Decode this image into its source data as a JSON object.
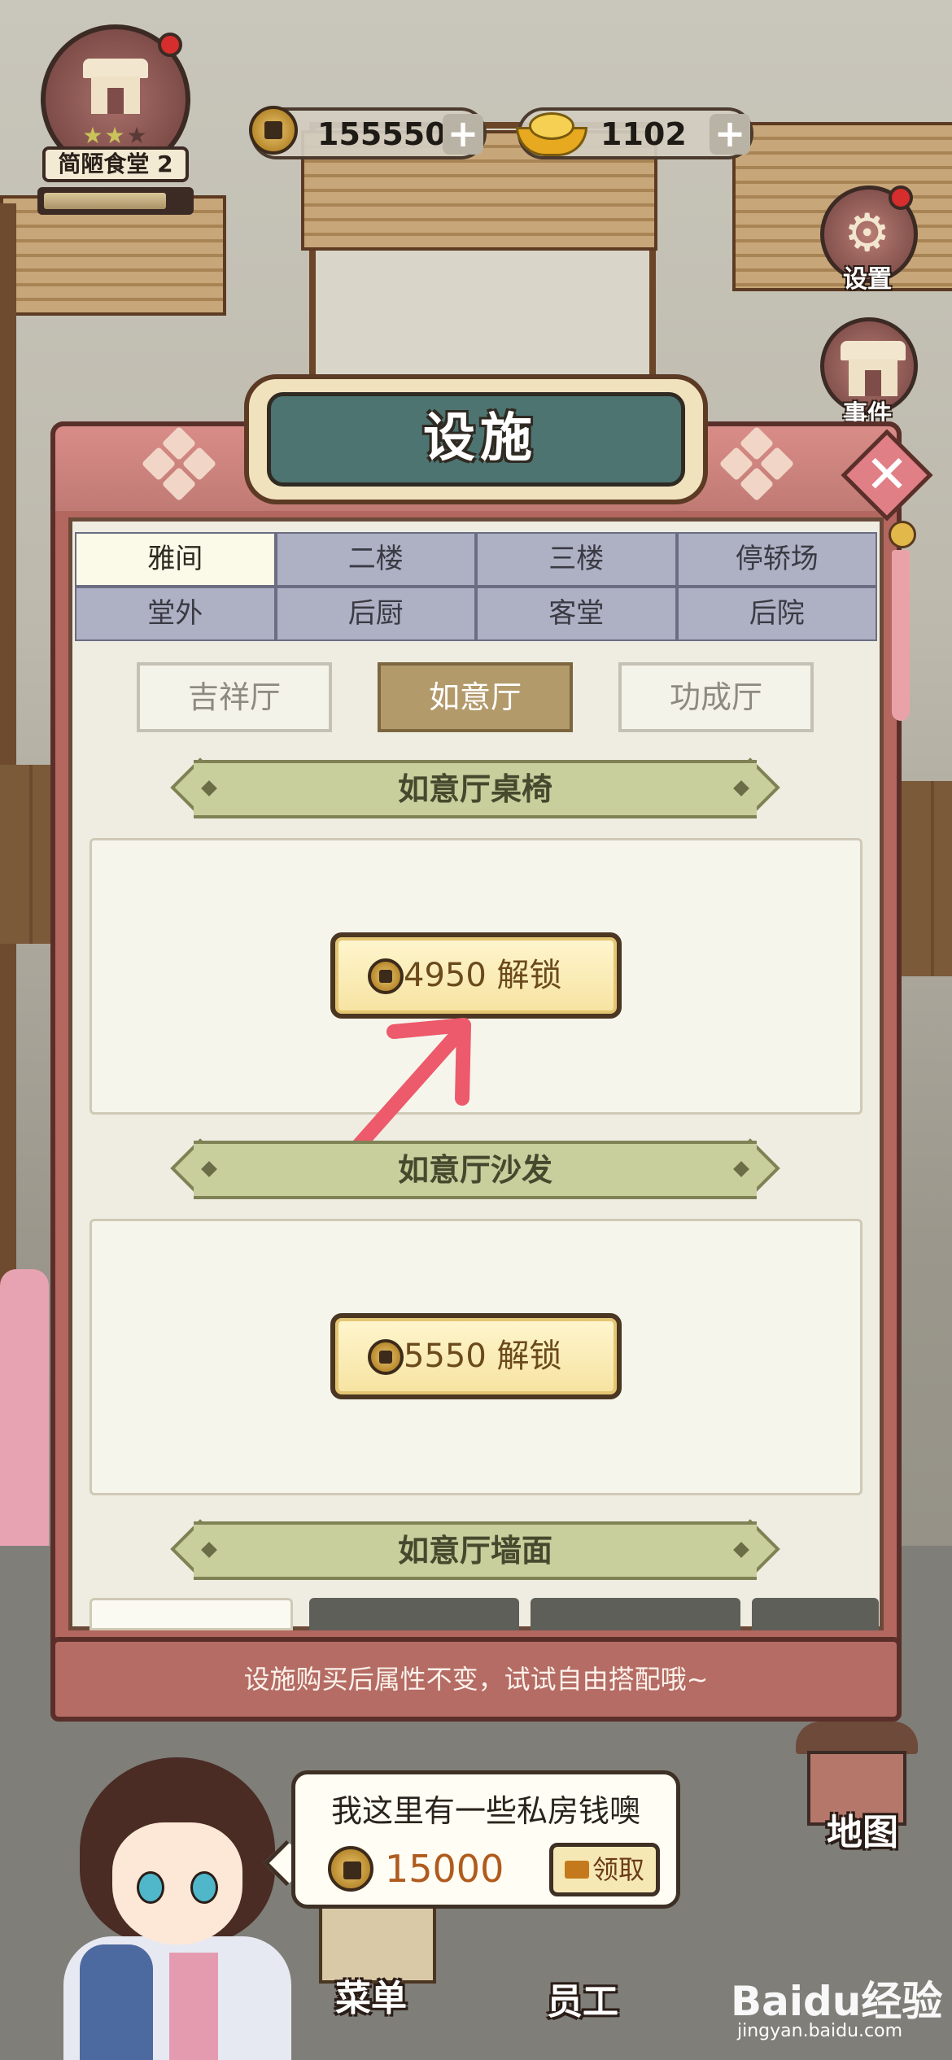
{
  "hud": {
    "restaurant_name": "简陋食堂 2",
    "stars_filled": 2,
    "stars_total": 3,
    "xp_progress": 0.85,
    "coins": "155550",
    "ingots": "1102",
    "plus_label": "+"
  },
  "side_buttons": {
    "settings_label": "设置",
    "events_label": "事件"
  },
  "panel": {
    "title": "设施",
    "close_label": "✕",
    "tabs": [
      {
        "label": "雅间",
        "active": true
      },
      {
        "label": "二楼",
        "active": false
      },
      {
        "label": "三楼",
        "active": false
      },
      {
        "label": "停轿场",
        "active": false
      },
      {
        "label": "堂外",
        "active": false
      },
      {
        "label": "后厨",
        "active": false
      },
      {
        "label": "客堂",
        "active": false
      },
      {
        "label": "后院",
        "active": false
      }
    ],
    "subtabs": [
      {
        "label": "吉祥厅",
        "active": false
      },
      {
        "label": "如意厅",
        "active": true
      },
      {
        "label": "功成厅",
        "active": false
      }
    ],
    "sections": [
      {
        "title": "如意厅桌椅",
        "unlock_label": "4950 解锁"
      },
      {
        "title": "如意厅沙发",
        "unlock_label": "5550 解锁"
      },
      {
        "title": "如意厅墙面"
      }
    ],
    "footer_tip": "设施购买后属性不变，试试自由搭配哦~"
  },
  "speech": {
    "text": "我这里有一些私房钱噢",
    "amount": "15000",
    "claim_label": "领取"
  },
  "bottom_nav": {
    "menu_label": "菜单",
    "staff_label": "员工",
    "map_label": "地图"
  },
  "watermark": {
    "logo": "Baidu经验",
    "url": "jingyan.baidu.com"
  },
  "colors": {
    "panel_frame": "#b3675f",
    "tab_active": "#fbfae8",
    "subtab_active": "#b39a6b",
    "banner": "#c8ce9c",
    "arrow": "#ec5a6b"
  }
}
